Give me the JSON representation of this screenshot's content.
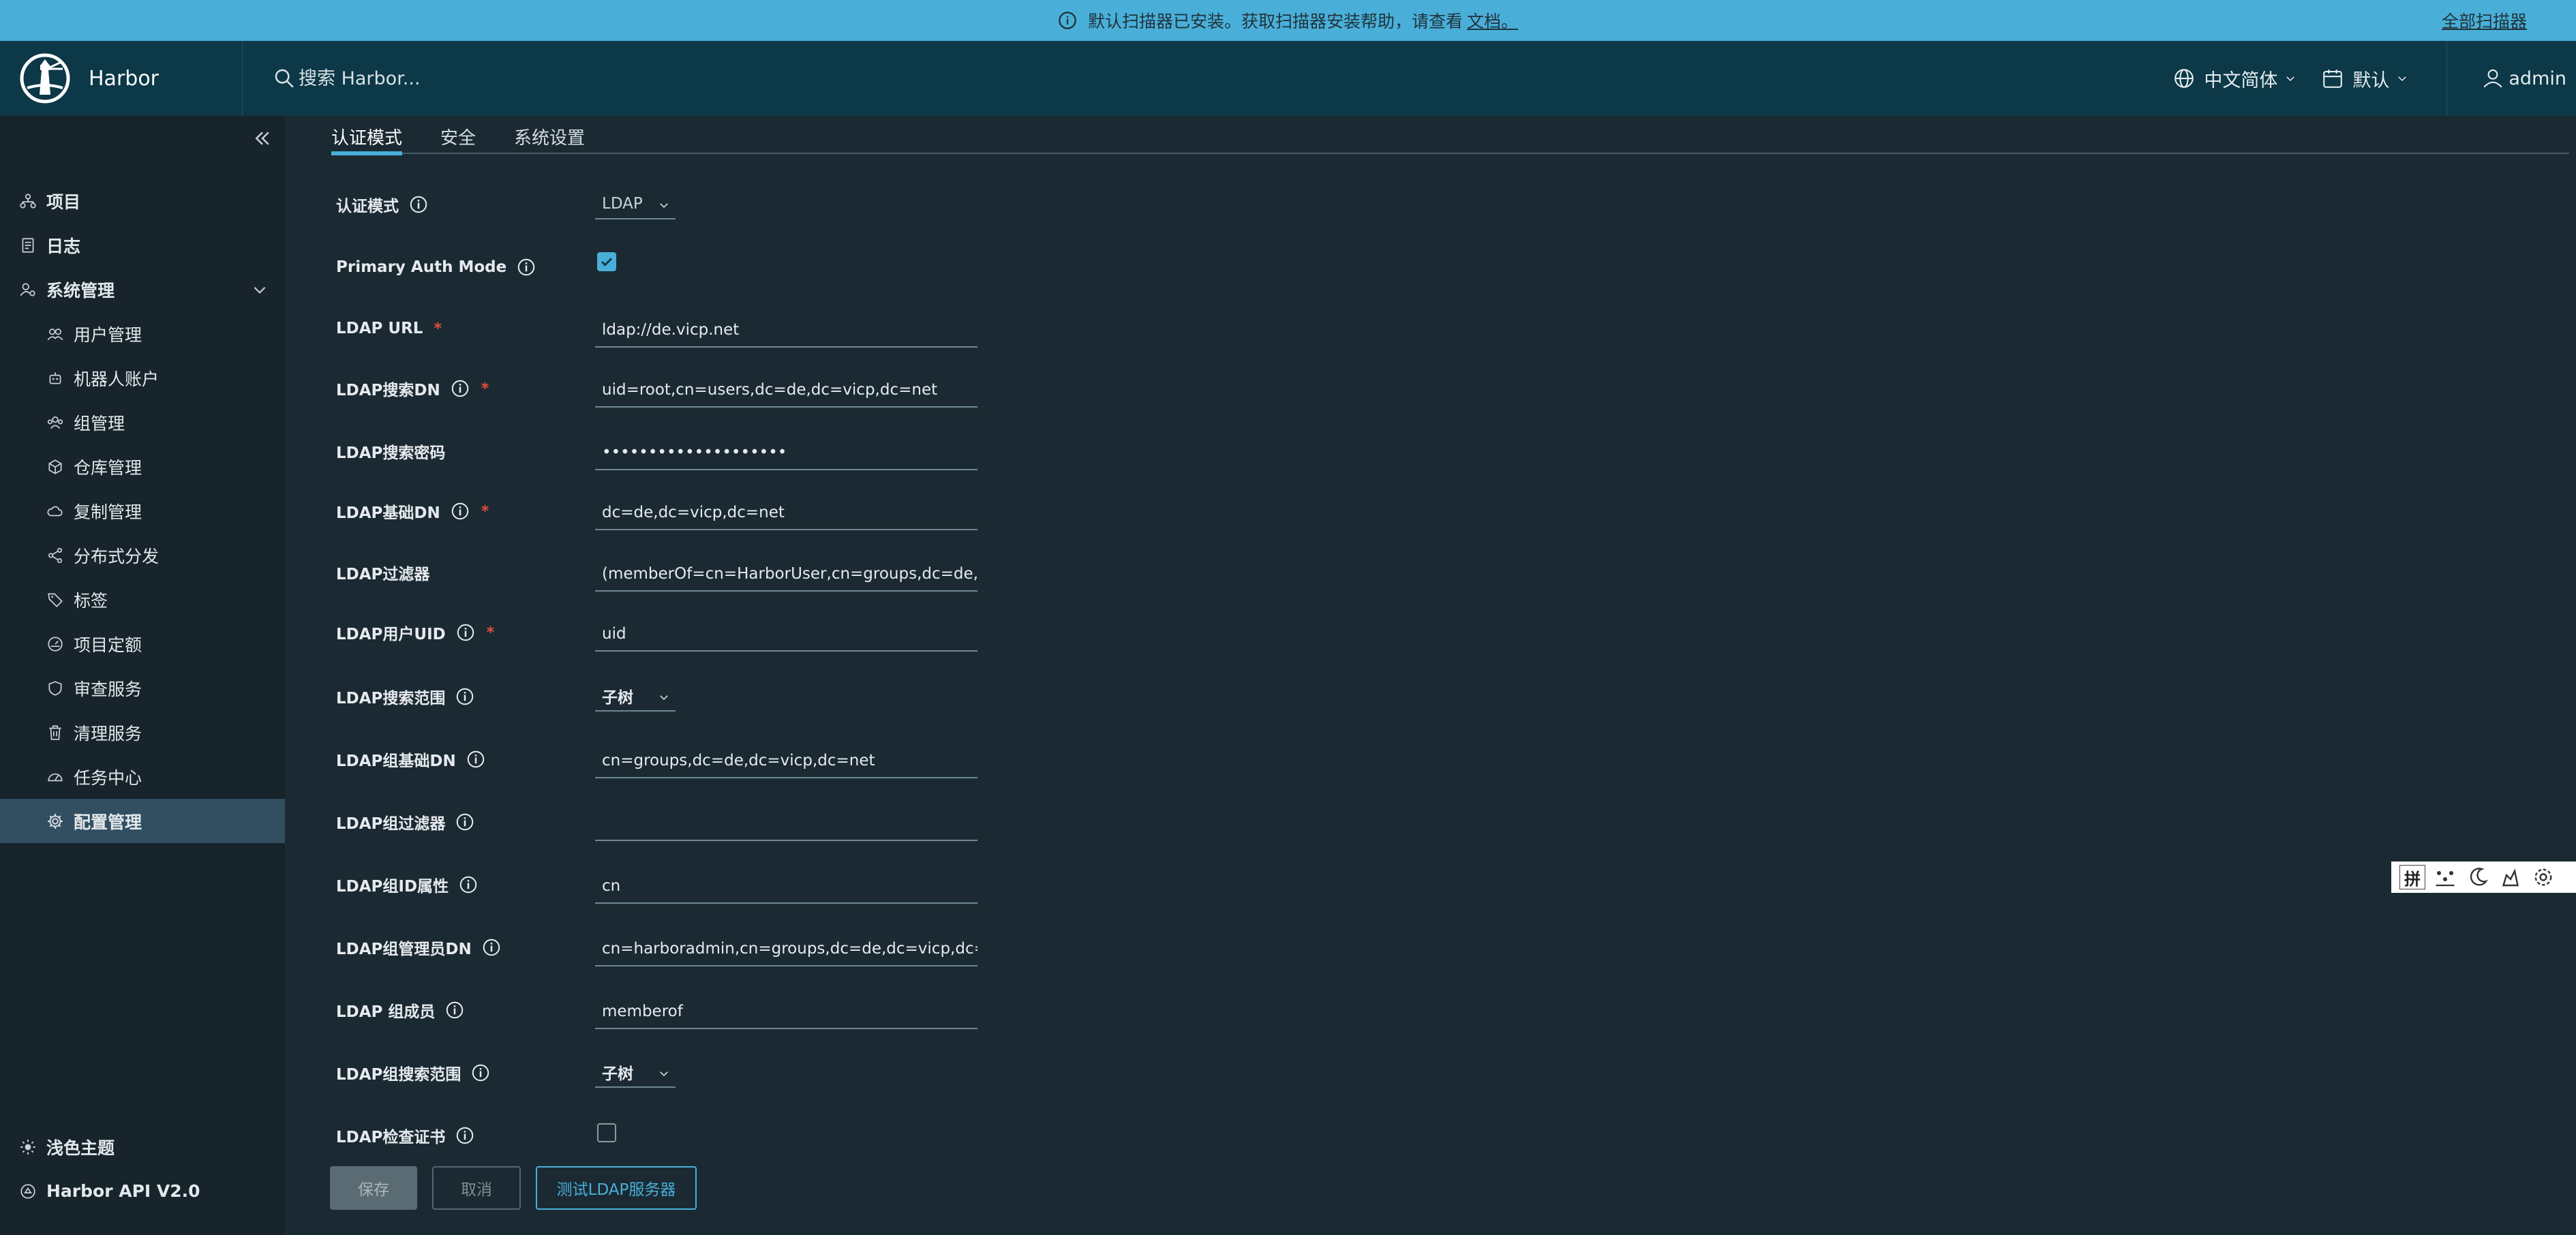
{
  "banner": {
    "message": "默认扫描器已安装。获取扫描器安装帮助，请查看",
    "doc_link": "文档。",
    "right_link": "全部扫描器"
  },
  "header": {
    "app_name": "Harbor",
    "search_placeholder": "搜索 Harbor...",
    "language": "中文简体",
    "theme": "默认",
    "user": "admin"
  },
  "sidebar": {
    "items": [
      {
        "label": "项目",
        "icon": "project-icon"
      },
      {
        "label": "日志",
        "icon": "log-icon"
      },
      {
        "label": "系统管理",
        "icon": "admin-icon"
      },
      {
        "label": "用户管理",
        "icon": "users-icon"
      },
      {
        "label": "机器人账户",
        "icon": "robot-icon"
      },
      {
        "label": "组管理",
        "icon": "group-icon"
      },
      {
        "label": "仓库管理",
        "icon": "registry-icon"
      },
      {
        "label": "复制管理",
        "icon": "replication-icon"
      },
      {
        "label": "分布式分发",
        "icon": "share-icon"
      },
      {
        "label": "标签",
        "icon": "tag-icon"
      },
      {
        "label": "项目定额",
        "icon": "quota-icon"
      },
      {
        "label": "审查服务",
        "icon": "shield-icon"
      },
      {
        "label": "清理服务",
        "icon": "trash-icon"
      },
      {
        "label": "任务中心",
        "icon": "dashboard-icon"
      },
      {
        "label": "配置管理",
        "icon": "gear-icon"
      }
    ],
    "bottom": [
      {
        "label": "浅色主题",
        "icon": "sun-icon"
      },
      {
        "label": "Harbor API V2.0",
        "icon": "api-icon"
      }
    ]
  },
  "tabs": [
    "认证模式",
    "安全",
    "系统设置"
  ],
  "form": {
    "auth_mode_label": "认证模式",
    "auth_mode_value": "LDAP",
    "primary_auth_label": "Primary Auth Mode",
    "primary_auth_checked": true,
    "ldap_url_label": "LDAP URL",
    "ldap_url_value": "ldap://de.vicp.net",
    "search_dn_label": "LDAP搜索DN",
    "search_dn_value": "uid=root,cn=users,dc=de,dc=vicp,dc=net",
    "search_pwd_label": "LDAP搜索密码",
    "search_pwd_value": "••••••••••••••••••••",
    "base_dn_label": "LDAP基础DN",
    "base_dn_value": "dc=de,dc=vicp,dc=net",
    "filter_label": "LDAP过滤器",
    "filter_value": "(memberOf=cn=HarborUser,cn=groups,dc=de,d",
    "uid_label": "LDAP用户UID",
    "uid_value": "uid",
    "scope_label": "LDAP搜索范围",
    "scope_value": "子树",
    "group_base_dn_label": "LDAP组基础DN",
    "group_base_dn_value": "cn=groups,dc=de,dc=vicp,dc=net",
    "group_filter_label": "LDAP组过滤器",
    "group_filter_value": "",
    "group_id_label": "LDAP组ID属性",
    "group_id_value": "cn",
    "group_admin_dn_label": "LDAP组管理员DN",
    "group_admin_dn_value": "cn=harboradmin,cn=groups,dc=de,dc=vicp,dc=n",
    "group_member_label": "LDAP 组成员",
    "group_member_value": "memberof",
    "group_scope_label": "LDAP组搜索范围",
    "group_scope_value": "子树",
    "verify_cert_label": "LDAP检查证书",
    "verify_cert_checked": false
  },
  "buttons": {
    "save": "保存",
    "cancel": "取消",
    "test": "测试LDAP服务器"
  },
  "ime_toolbar": {
    "mode": "拼"
  },
  "colors": {
    "accent": "#49afd9",
    "header_bg": "#0c3847",
    "page_bg": "#1b2a32",
    "sidebar_bg": "#17242b",
    "required": "#e74c3c"
  }
}
